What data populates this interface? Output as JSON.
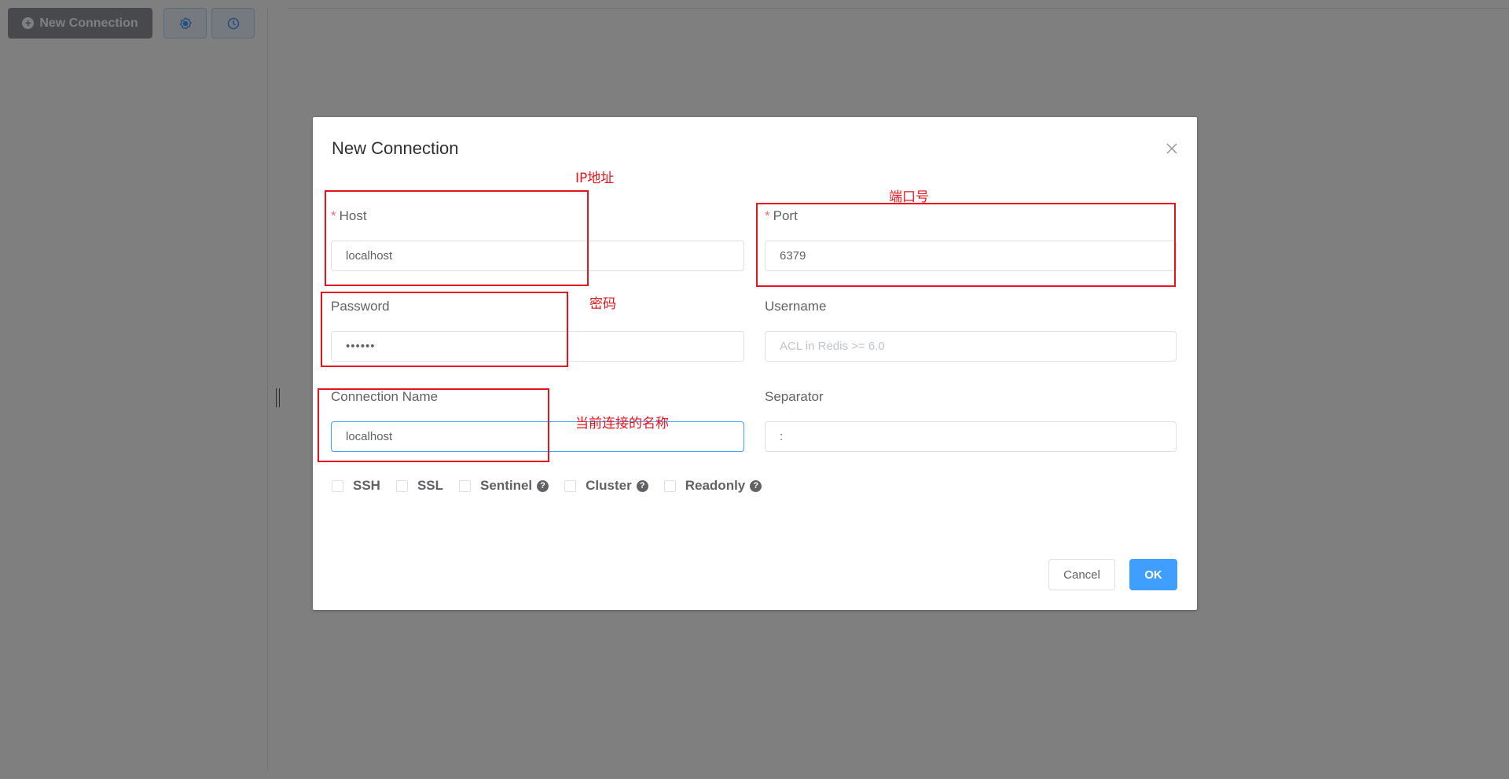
{
  "app": {
    "toolbar": {
      "new_connection_label": "New Connection",
      "new_connection_icon": "plus-circle-icon",
      "settings_icon": "gear-icon",
      "history_icon": "clock-icon"
    }
  },
  "dialog": {
    "title": "New Connection",
    "close_icon": "close-icon",
    "fields": {
      "host": {
        "label": "Host",
        "required_mark": "*",
        "value": "localhost"
      },
      "port": {
        "label": "Port",
        "required_mark": "*",
        "value": "6379"
      },
      "password": {
        "label": "Password",
        "value": "••••••"
      },
      "username": {
        "label": "Username",
        "value": "",
        "placeholder": "ACL in Redis >= 6.0"
      },
      "connection_name": {
        "label": "Connection Name",
        "value": "localhost"
      },
      "separator": {
        "label": "Separator",
        "value": ":"
      }
    },
    "options": [
      {
        "label": "SSH",
        "checked": false,
        "help": false
      },
      {
        "label": "SSL",
        "checked": false,
        "help": false
      },
      {
        "label": "Sentinel",
        "checked": false,
        "help": true
      },
      {
        "label": "Cluster",
        "checked": false,
        "help": true
      },
      {
        "label": "Readonly",
        "checked": false,
        "help": true
      }
    ],
    "help_glyph": "?",
    "buttons": {
      "cancel": "Cancel",
      "ok": "OK"
    }
  },
  "annotations": {
    "host": "IP地址",
    "port": "端口号",
    "password": "密码",
    "connection_name": "当前连接的名称",
    "color": "#e8141d"
  },
  "colors": {
    "primary": "#409eff",
    "required": "#f56c6c",
    "overlay": "rgba(0,0,0,0.5)"
  }
}
